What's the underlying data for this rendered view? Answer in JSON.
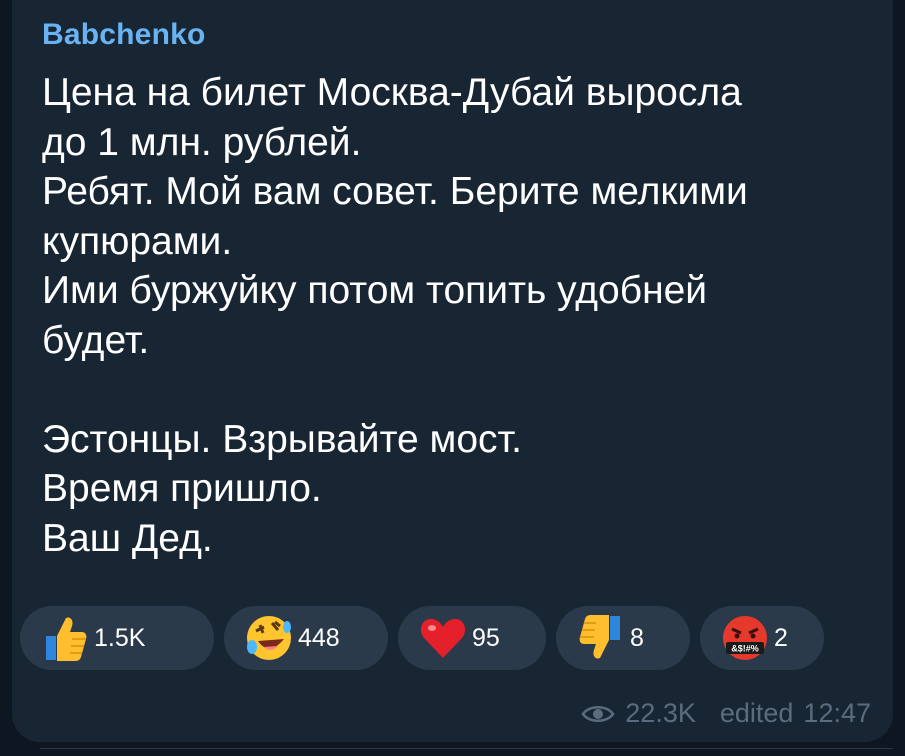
{
  "post": {
    "author": "Babchenko",
    "lines": [
      "Цена на билет Москва-Дубай выросла",
      "до 1 млн. рублей.",
      "Ребят. Мой вам совет. Берите мелкими",
      "купюрами.",
      "Ими буржуйку потом топить удобней",
      "будет.",
      "",
      "Эстонцы. Взрывайте мост.",
      "Время пришло.",
      "Ваш Дед."
    ],
    "views": "22.3K",
    "edited_label": "edited",
    "time": "12:47"
  },
  "reactions": [
    {
      "icon": "thumbs-up-icon",
      "count": "1.5K"
    },
    {
      "icon": "rofl-emoji-icon",
      "count": "448"
    },
    {
      "icon": "heart-icon",
      "count": "95"
    },
    {
      "icon": "thumbs-down-icon",
      "count": "8"
    },
    {
      "icon": "swearing-face-icon",
      "count": "2",
      "icon_text": "&$!#%"
    }
  ],
  "colors": {
    "author": "#6ab3f3",
    "bubble": "#182533",
    "reaction_pill": "#2b3a4a",
    "meta": "#5b6c7e"
  }
}
